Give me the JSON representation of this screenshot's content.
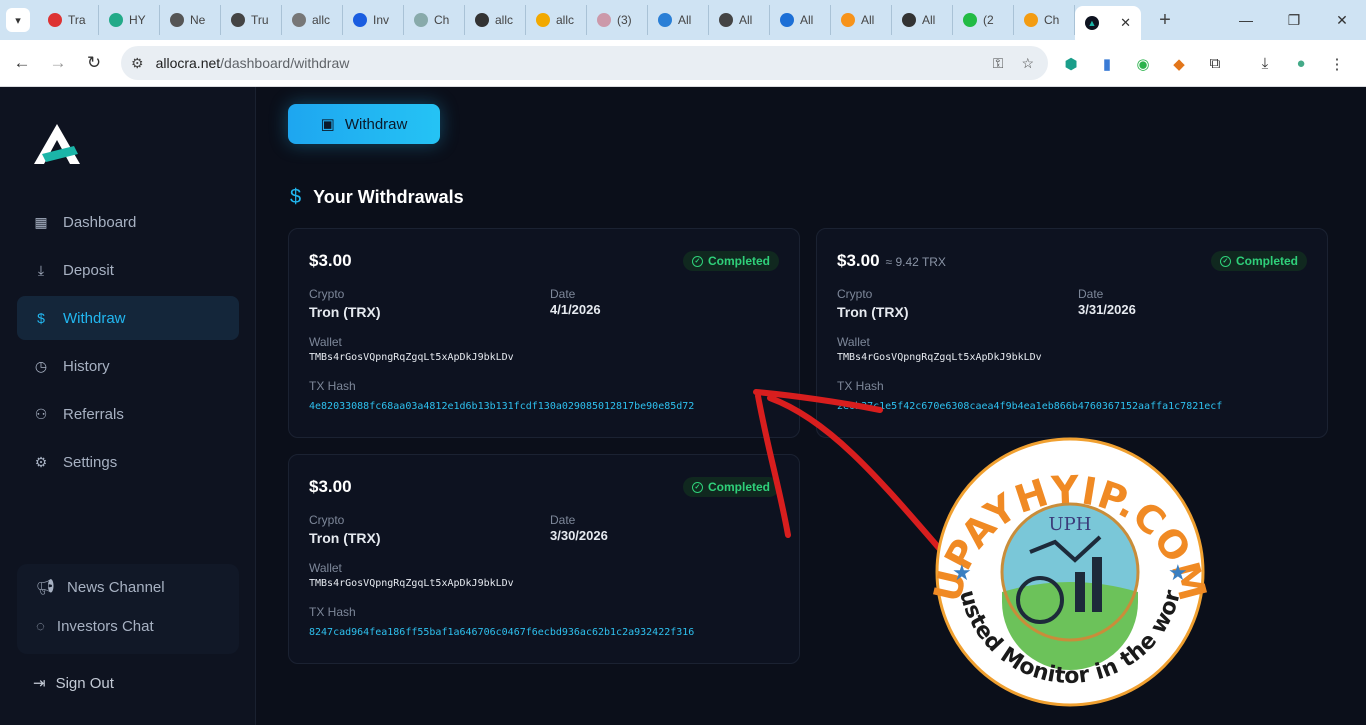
{
  "browser": {
    "tabs": [
      {
        "title": "Tra",
        "color": "#d33"
      },
      {
        "title": "HY",
        "color": "#2a8"
      },
      {
        "title": "Ne",
        "color": "#555"
      },
      {
        "title": "Tru",
        "color": "#444"
      },
      {
        "title": "allc",
        "color": "#777"
      },
      {
        "title": "Inv",
        "color": "#1a5de0"
      },
      {
        "title": "Ch",
        "color": "#8aa"
      },
      {
        "title": "allc",
        "color": "#333"
      },
      {
        "title": "allc",
        "color": "#f2a900"
      },
      {
        "title": "(3)",
        "color": "#c9a"
      },
      {
        "title": "All",
        "color": "#2a7fd6"
      },
      {
        "title": "All",
        "color": "#444"
      },
      {
        "title": "All",
        "color": "#1c6fd6"
      },
      {
        "title": "All",
        "color": "#f7931a"
      },
      {
        "title": "All",
        "color": "#333"
      },
      {
        "title": "(2",
        "color": "#2b4"
      },
      {
        "title": "Ch",
        "color": "#f39c12"
      }
    ],
    "url_host": "allocra.net",
    "url_path": "/dashboard/withdraw"
  },
  "sidebar": {
    "items": [
      {
        "label": "Dashboard",
        "icon": "grid-icon"
      },
      {
        "label": "Deposit",
        "icon": "download-icon"
      },
      {
        "label": "Withdraw",
        "icon": "dollar-icon"
      },
      {
        "label": "History",
        "icon": "clock-icon"
      },
      {
        "label": "Referrals",
        "icon": "users-icon"
      },
      {
        "label": "Settings",
        "icon": "gear-icon"
      }
    ],
    "community": {
      "news": "News Channel",
      "chat": "Investors Chat"
    },
    "signout": "Sign Out"
  },
  "main": {
    "withdraw_button": "Withdraw",
    "section_title": "Your Withdrawals",
    "labels": {
      "crypto": "Crypto",
      "date": "Date",
      "wallet": "Wallet",
      "tx_hash": "TX Hash"
    },
    "withdrawals": [
      {
        "amount": "$3.00",
        "approx": "",
        "status": "Completed",
        "crypto": "Tron (TRX)",
        "date": "4/1/2026",
        "wallet": "TMBs4rGosVQpngRqZgqLt5xApDkJ9bkLDv",
        "tx_hash": "4e82033088fc68aa03a4812e1d6b13b131fcdf130a029085012817be90e85d72"
      },
      {
        "amount": "$3.00",
        "approx": "≈ 9.42 TRX",
        "status": "Completed",
        "crypto": "Tron (TRX)",
        "date": "3/31/2026",
        "wallet": "TMBs4rGosVQpngRqZgqLt5xApDkJ9bkLDv",
        "tx_hash": "2e6b37c1e5f42c670e6308caea4f9b4ea1eb866b4760367152aaffa1c7821ecf"
      },
      {
        "amount": "$3.00",
        "approx": "",
        "status": "Completed",
        "crypto": "Tron (TRX)",
        "date": "3/30/2026",
        "wallet": "TMBs4rGosVQpngRqZgqLt5xApDkJ9bkLDv",
        "tx_hash": "8247cad964fea186ff55baf1a646706c0467f6ecbd936ac62b1c2a932422f316"
      }
    ]
  },
  "watermark": {
    "top_text": "UPAYHYIP.COM",
    "bottom_text": "Trusted Monitor in the world",
    "inner_text": "UPH"
  },
  "colors": {
    "accent": "#22b7f0",
    "success": "#2fd07a",
    "background": "#0b0f1a",
    "annotation": "#d81e1e"
  }
}
